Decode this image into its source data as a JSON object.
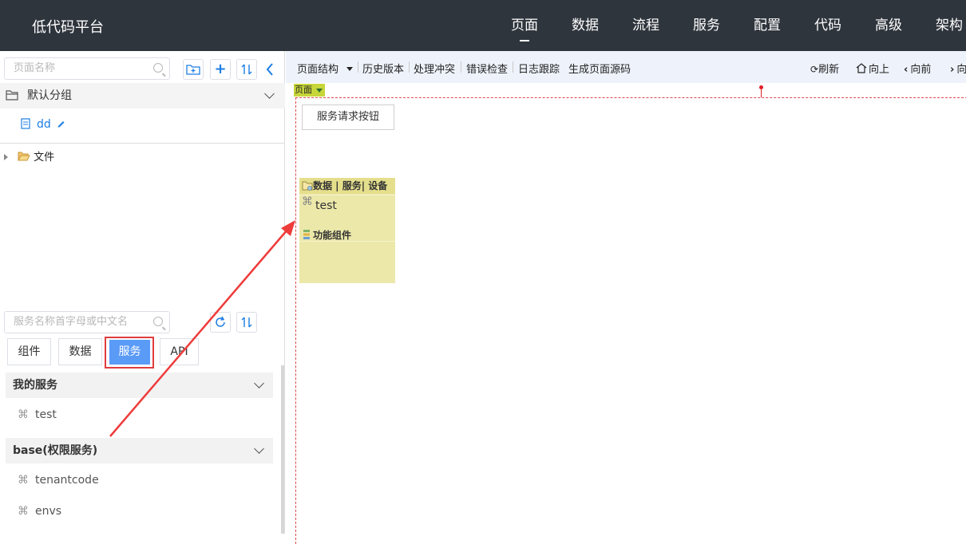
{
  "app": {
    "title": "低代码平台"
  },
  "topnav": [
    {
      "label": "页面",
      "active": true
    },
    {
      "label": "数据",
      "active": false
    },
    {
      "label": "流程",
      "active": false
    },
    {
      "label": "服务",
      "active": false
    },
    {
      "label": "配置",
      "active": false
    },
    {
      "label": "代码",
      "active": false
    },
    {
      "label": "高级",
      "active": false
    },
    {
      "label": "架构",
      "active": false
    }
  ],
  "left": {
    "page_search": {
      "placeholder": "页面名称"
    },
    "buttons": {
      "add_folder": "add-folder-icon",
      "add": "+",
      "sort": "sort-icon",
      "collapse": "chevron-left-icon"
    },
    "default_group": {
      "label": "默认分组"
    },
    "page_item": {
      "label": "dd"
    },
    "folder": {
      "label": "文件"
    },
    "service_search": {
      "placeholder": "服务名称首字母或中文名"
    },
    "tabs": [
      {
        "label": "组件"
      },
      {
        "label": "数据"
      },
      {
        "label": "服务",
        "active": true
      },
      {
        "label": "API"
      }
    ],
    "service_groups": [
      {
        "title": "我的服务",
        "items": [
          "test"
        ]
      },
      {
        "title": "base(权限服务)",
        "items": [
          "tenantcode",
          "envs"
        ]
      }
    ]
  },
  "toolbar": {
    "page_structure": "页面结构",
    "history": "历史版本",
    "conflict": "处理冲突",
    "error_check": "错误检查",
    "log_trace": "日志跟踪",
    "gen_source": "生成页面源码",
    "refresh": "刷新",
    "up": "向上",
    "forward": "向前",
    "next": "向"
  },
  "canvas": {
    "page_badge": "页面",
    "request_button": "服务请求按钮",
    "panel": {
      "header": "数据 | 服务| 设备",
      "item": "test",
      "section": "功能组件"
    }
  },
  "colors": {
    "topbar": "#2f353d",
    "accent": "#1d7ee4",
    "active_tab": "#5b9bf8",
    "highlight_border": "#e03c3c",
    "panel_yellow": "#ece8a9"
  }
}
